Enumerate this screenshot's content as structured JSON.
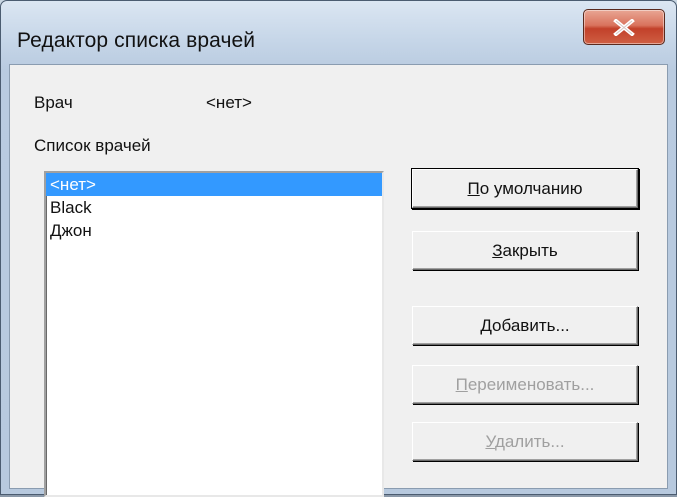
{
  "window": {
    "title": "Редактор списка врачей",
    "close_glyph": "X"
  },
  "doctor": {
    "label": "Врач",
    "value": "<нет>"
  },
  "list": {
    "label": "Список врачей",
    "items": [
      "<нет>",
      "Black",
      "Джон"
    ],
    "selected_index": 0
  },
  "buttons": {
    "default": {
      "mnemonic": "П",
      "rest": "о умолчанию",
      "enabled": true
    },
    "close": {
      "mnemonic": "З",
      "rest": "акрыть",
      "enabled": true
    },
    "add": {
      "mnemonic": "Д",
      "rest": "обавить...",
      "enabled": true
    },
    "rename": {
      "mnemonic": "П",
      "rest": "ереименовать...",
      "enabled": false
    },
    "delete": {
      "mnemonic": "У",
      "rest": "далить...",
      "enabled": false
    }
  },
  "colors": {
    "selection": "#3399ff",
    "close_button": "#c2412a",
    "dialog_face": "#f0f0f0",
    "disabled_text": "#a0a0a0"
  }
}
